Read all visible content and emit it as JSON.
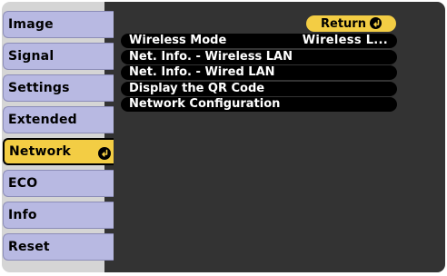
{
  "sidebar": {
    "items": [
      {
        "label": "Image"
      },
      {
        "label": "Signal"
      },
      {
        "label": "Settings"
      },
      {
        "label": "Extended"
      },
      {
        "label": "Network"
      },
      {
        "label": "ECO"
      },
      {
        "label": "Info"
      },
      {
        "label": "Reset"
      }
    ],
    "active": "Network"
  },
  "main": {
    "return_label": "Return",
    "rows": [
      {
        "label": "Wireless Mode",
        "value": "Wireless L..."
      },
      {
        "label": "Net. Info. - Wireless LAN",
        "value": ""
      },
      {
        "label": "Net. Info. - Wired LAN",
        "value": ""
      },
      {
        "label": "Display the QR Code",
        "value": ""
      },
      {
        "label": "Network Configuration",
        "value": ""
      }
    ]
  },
  "colors": {
    "accent": "#f3cd44",
    "tab": "#b8b9e2",
    "panel": "#333333",
    "row": "#000000"
  },
  "icons": {
    "enter": "enter-key-icon"
  }
}
